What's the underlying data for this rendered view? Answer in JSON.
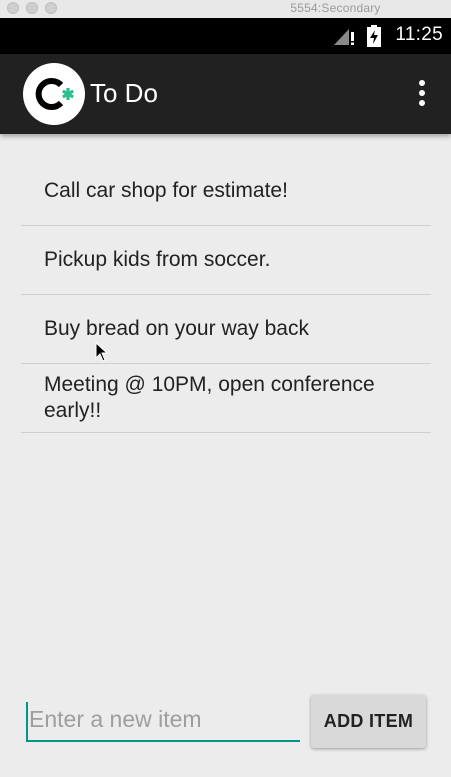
{
  "window": {
    "title": "5554:Secondary"
  },
  "status_bar": {
    "time": "11:25",
    "icons": [
      "signal-icon",
      "battery-icon"
    ]
  },
  "app_bar": {
    "title": "To Do",
    "logo_letter": "C",
    "logo_mark": "*",
    "icons": [
      "logo-icon",
      "overflow-menu-icon"
    ]
  },
  "todo": {
    "items": [
      {
        "text": "Call car shop for estimate!"
      },
      {
        "text": "Pickup kids from soccer."
      },
      {
        "text": "Buy bread on your way back"
      },
      {
        "text": "Meeting @ 10PM, open conference early!!"
      }
    ]
  },
  "new_item": {
    "value": "",
    "placeholder": "Enter a new item",
    "add_label": "ADD ITEM"
  },
  "colors": {
    "app_bar": "#212121",
    "status_bar": "#000000",
    "background": "#ececec",
    "accent": "#009688",
    "logo_mark": "#2bbf8e",
    "button": "#d9d9d9"
  }
}
